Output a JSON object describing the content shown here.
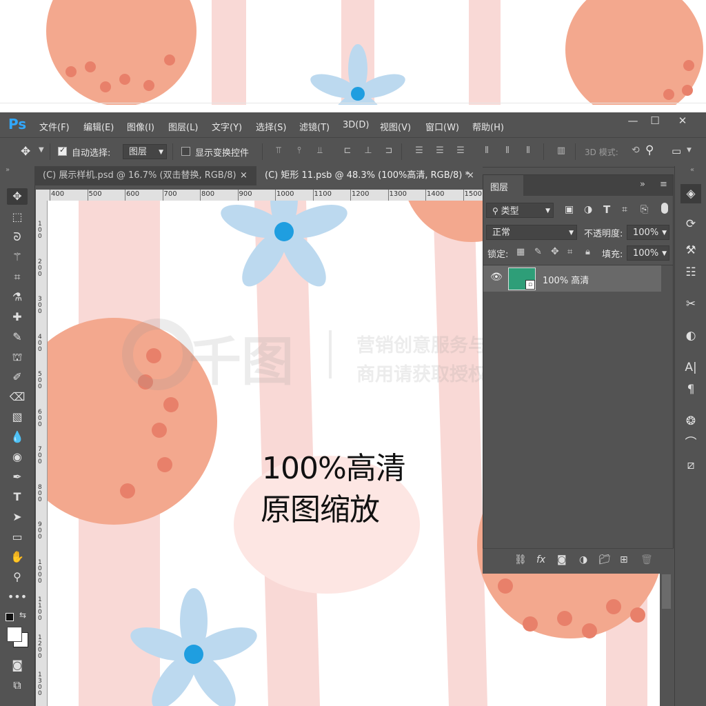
{
  "app": {
    "logo": "Ps"
  },
  "menu": [
    "文件(F)",
    "编辑(E)",
    "图像(I)",
    "图层(L)",
    "文字(Y)",
    "选择(S)",
    "滤镜(T)",
    "3D(D)",
    "视图(V)",
    "窗口(W)",
    "帮助(H)"
  ],
  "window_buttons": {
    "minimize": "—",
    "restore": "☐",
    "close": "✕"
  },
  "options": {
    "auto_select_label": "自动选择:",
    "auto_select_checked": true,
    "auto_select_value": "图层",
    "show_transform_label": "显示变换控件",
    "mode_3d_label": "3D 模式:"
  },
  "tabs": [
    {
      "label": "(C) 展示样机.psd @ 16.7% (双击替换, RGB/8)",
      "close": "×",
      "active": false
    },
    {
      "label": "(C) 矩形 11.psb @ 48.3% (100%高清, RGB/8) *",
      "close": "×",
      "active": true
    }
  ],
  "ruler_h": [
    "400",
    "500",
    "600",
    "700",
    "800",
    "900",
    "1000",
    "1100",
    "1200",
    "1300",
    "1400",
    "1500"
  ],
  "ruler_v": [
    "100",
    "200",
    "300",
    "400",
    "500",
    "600",
    "700",
    "800",
    "900",
    "1000",
    "1100",
    "1200",
    "1300"
  ],
  "canvas": {
    "caption_line1": "100%高清",
    "caption_line2": "原图缩放",
    "watermark_brand": "千图",
    "watermark_line1": "营销创意服务与协作平台",
    "watermark_line2": "商用请获取授权"
  },
  "layers_panel": {
    "title": "图层",
    "filter_label": "类型",
    "blend_mode": "正常",
    "opacity_label": "不透明度:",
    "opacity_value": "100%",
    "lock_label": "锁定:",
    "fill_label": "填充:",
    "fill_value": "100%",
    "layers": [
      {
        "name": "100% 高清",
        "visible": true,
        "thumb_color": "#2e9e78"
      }
    ]
  },
  "colors": {
    "accent": "#31a8ff",
    "peach": "#f3a88e",
    "pink_stripe": "#f9d9d6",
    "flower_blue": "#bcd9ef",
    "flower_center": "#1f9ee0"
  }
}
